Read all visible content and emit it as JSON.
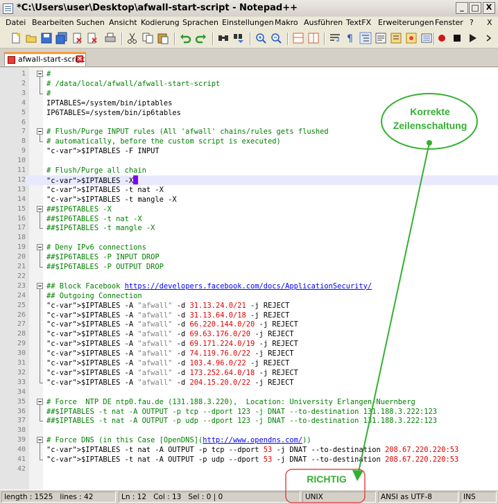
{
  "window": {
    "title": "*C:\\Users\\user\\Desktop\\afwall-start-script - Notepad++",
    "minimize": "_",
    "maximize": "□",
    "close": "X"
  },
  "menu": [
    "Datei",
    "Bearbeiten",
    "Suchen",
    "Ansicht",
    "Kodierung",
    "Sprachen",
    "Einstellungen",
    "Makro",
    "Ausführen",
    "TextFX",
    "Erweiterungen",
    "Fenster",
    "?",
    "X"
  ],
  "tab": {
    "label": "afwall-start-script"
  },
  "editor": {
    "lines": [
      "#",
      "# /data/local/afwall/afwall-start-script",
      "#",
      "IPTABLES=/system/bin/iptables",
      "IP6TABLES=/system/bin/ip6tables",
      "",
      "# Flush/Purge INPUT rules (All 'afwall' chains/rules gets flushed",
      "# automatically, before the custom script is executed)",
      "$IPTABLES -F INPUT",
      "",
      "# Flush/Purge all chain",
      "$IPTABLES -X",
      "$IPTABLES -t nat -X",
      "$IPTABLES -t mangle -X",
      "##$IP6TABLES -X",
      "##$IP6TABLES -t nat -X",
      "##$IP6TABLES -t mangle -X",
      "",
      "# Deny IPv6 connections",
      "##$IP6TABLES -P INPUT DROP",
      "##$IP6TABLES -P OUTPUT DROP",
      "",
      "## Block Facebook https://developers.facebook.com/docs/ApplicationSecurity/",
      "## Outgoing Connection",
      "$IPTABLES -A \"afwall\" -d 31.13.24.0/21 -j REJECT",
      "$IPTABLES -A \"afwall\" -d 31.13.64.0/18 -j REJECT",
      "$IPTABLES -A \"afwall\" -d 66.220.144.0/20 -j REJECT",
      "$IPTABLES -A \"afwall\" -d 69.63.176.0/20 -j REJECT",
      "$IPTABLES -A \"afwall\" -d 69.171.224.0/19 -j REJECT",
      "$IPTABLES -A \"afwall\" -d 74.119.76.0/22 -j REJECT",
      "$IPTABLES -A \"afwall\" -d 103.4.96.0/22 -j REJECT",
      "$IPTABLES -A \"afwall\" -d 173.252.64.0/18 -j REJECT",
      "$IPTABLES -A \"afwall\" -d 204.15.20.0/22 -j REJECT",
      "",
      "# Force  NTP DE ntp0.fau.de (131.188.3.220),  Location: University Erlangen-Nuernberg",
      "##$IPTABLES -t nat -A OUTPUT -p tcp --dport 123 -j DNAT --to-destination 131.188.3.222:123",
      "##$IPTABLES -t nat -A OUTPUT -p udp --dport 123 -j DNAT --to-destination 131.188.3.222:123",
      "",
      "# Force DNS (in this Case [OpenDNS](http://www.opendns.com/))",
      "$IPTABLES -t nat -A OUTPUT -p tcp --dport 53 -j DNAT --to-destination 208.67.220.220:53",
      "$IPTABLES -t nat -A OUTPUT -p udp --dport 53 -j DNAT --to-destination 208.67.220.220:53",
      ""
    ],
    "current_line": 12
  },
  "status": {
    "length": "length : 1525",
    "lines": "lines : 42",
    "ln": "Ln : 12",
    "col": "Col : 13",
    "sel": "Sel : 0 | 0",
    "eol": "UNIX",
    "encoding": "ANSI as UTF-8",
    "mode": "INS"
  },
  "annotations": {
    "bubble_line1": "Korrekte",
    "bubble_line2": "Zeilenschaltung",
    "box_label": "RICHTIG",
    "color": "#33b030"
  }
}
